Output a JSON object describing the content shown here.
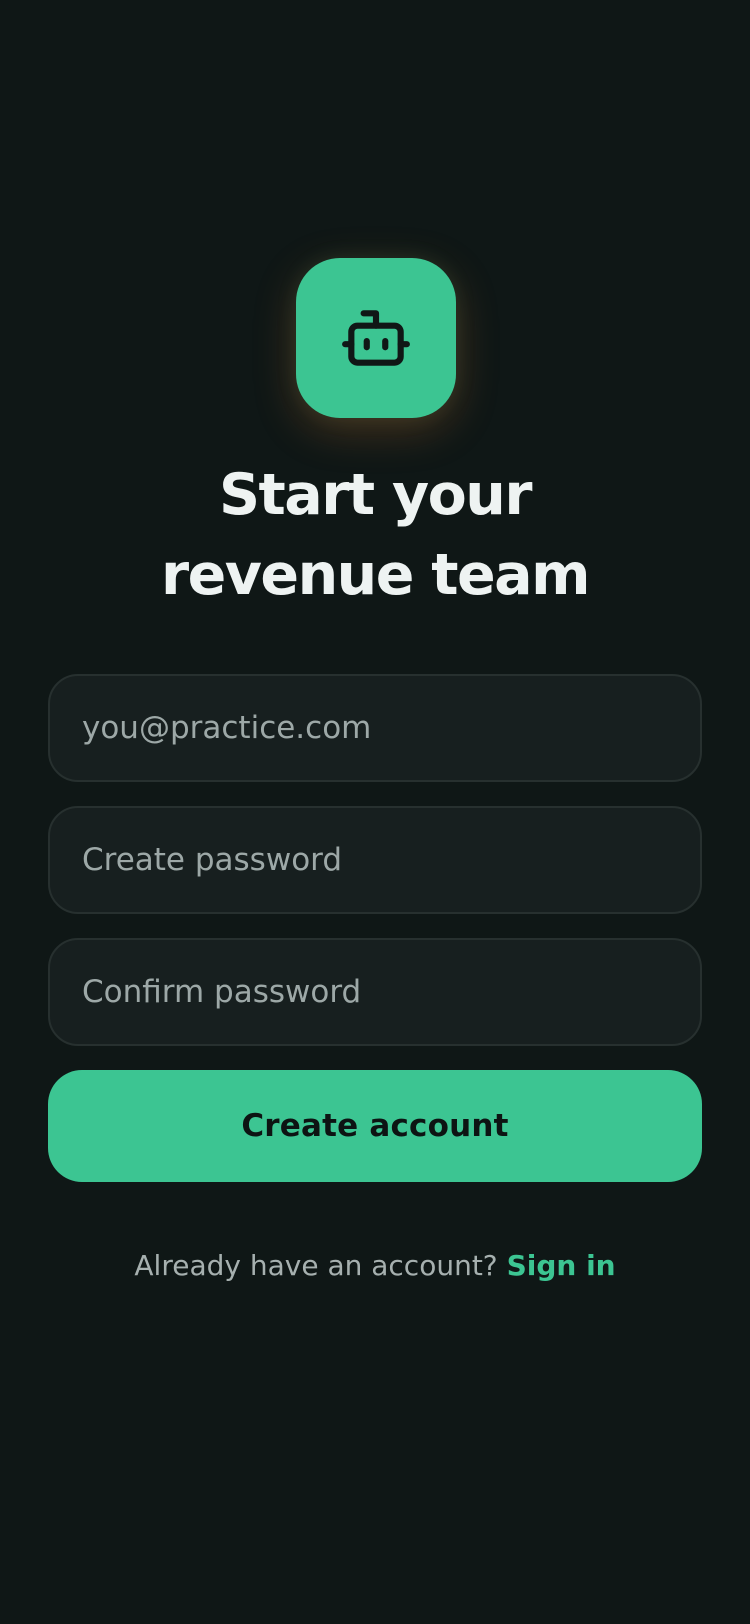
{
  "brand": {
    "icon": "robot-icon",
    "accent_color": "#3cc592",
    "background_color": "#0f1716"
  },
  "heading": {
    "line1": "Start your",
    "line2": "revenue team"
  },
  "form": {
    "email_placeholder": "you@practice.com",
    "password_placeholder": "Create password",
    "confirm_placeholder": "Confirm password",
    "submit_label": "Create account"
  },
  "footer": {
    "prompt": "Already have an account?",
    "link": "Sign in"
  }
}
